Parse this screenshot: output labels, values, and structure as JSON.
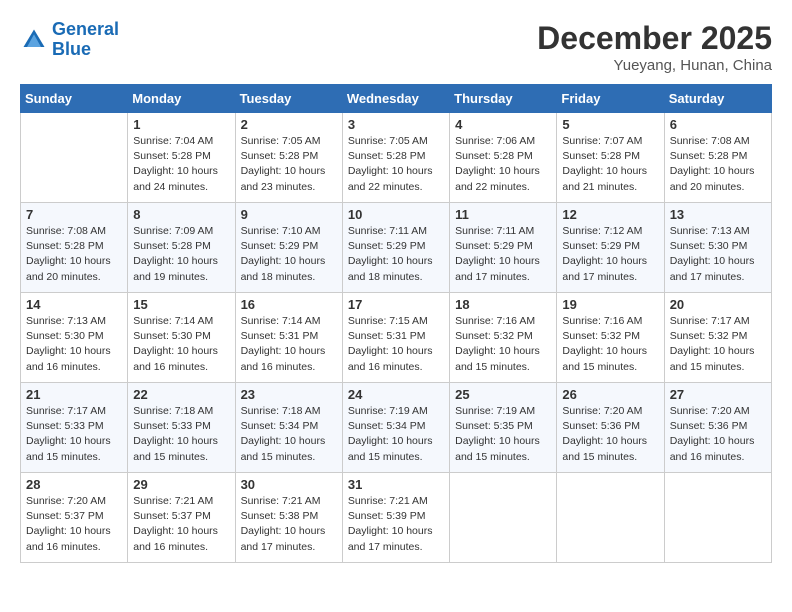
{
  "header": {
    "logo_line1": "General",
    "logo_line2": "Blue",
    "month": "December 2025",
    "location": "Yueyang, Hunan, China"
  },
  "weekdays": [
    "Sunday",
    "Monday",
    "Tuesday",
    "Wednesday",
    "Thursday",
    "Friday",
    "Saturday"
  ],
  "weeks": [
    [
      {
        "num": "",
        "sunrise": "",
        "sunset": "",
        "daylight": ""
      },
      {
        "num": "1",
        "sunrise": "Sunrise: 7:04 AM",
        "sunset": "Sunset: 5:28 PM",
        "daylight": "Daylight: 10 hours and 24 minutes."
      },
      {
        "num": "2",
        "sunrise": "Sunrise: 7:05 AM",
        "sunset": "Sunset: 5:28 PM",
        "daylight": "Daylight: 10 hours and 23 minutes."
      },
      {
        "num": "3",
        "sunrise": "Sunrise: 7:05 AM",
        "sunset": "Sunset: 5:28 PM",
        "daylight": "Daylight: 10 hours and 22 minutes."
      },
      {
        "num": "4",
        "sunrise": "Sunrise: 7:06 AM",
        "sunset": "Sunset: 5:28 PM",
        "daylight": "Daylight: 10 hours and 22 minutes."
      },
      {
        "num": "5",
        "sunrise": "Sunrise: 7:07 AM",
        "sunset": "Sunset: 5:28 PM",
        "daylight": "Daylight: 10 hours and 21 minutes."
      },
      {
        "num": "6",
        "sunrise": "Sunrise: 7:08 AM",
        "sunset": "Sunset: 5:28 PM",
        "daylight": "Daylight: 10 hours and 20 minutes."
      }
    ],
    [
      {
        "num": "7",
        "sunrise": "Sunrise: 7:08 AM",
        "sunset": "Sunset: 5:28 PM",
        "daylight": "Daylight: 10 hours and 20 minutes."
      },
      {
        "num": "8",
        "sunrise": "Sunrise: 7:09 AM",
        "sunset": "Sunset: 5:28 PM",
        "daylight": "Daylight: 10 hours and 19 minutes."
      },
      {
        "num": "9",
        "sunrise": "Sunrise: 7:10 AM",
        "sunset": "Sunset: 5:29 PM",
        "daylight": "Daylight: 10 hours and 18 minutes."
      },
      {
        "num": "10",
        "sunrise": "Sunrise: 7:11 AM",
        "sunset": "Sunset: 5:29 PM",
        "daylight": "Daylight: 10 hours and 18 minutes."
      },
      {
        "num": "11",
        "sunrise": "Sunrise: 7:11 AM",
        "sunset": "Sunset: 5:29 PM",
        "daylight": "Daylight: 10 hours and 17 minutes."
      },
      {
        "num": "12",
        "sunrise": "Sunrise: 7:12 AM",
        "sunset": "Sunset: 5:29 PM",
        "daylight": "Daylight: 10 hours and 17 minutes."
      },
      {
        "num": "13",
        "sunrise": "Sunrise: 7:13 AM",
        "sunset": "Sunset: 5:30 PM",
        "daylight": "Daylight: 10 hours and 17 minutes."
      }
    ],
    [
      {
        "num": "14",
        "sunrise": "Sunrise: 7:13 AM",
        "sunset": "Sunset: 5:30 PM",
        "daylight": "Daylight: 10 hours and 16 minutes."
      },
      {
        "num": "15",
        "sunrise": "Sunrise: 7:14 AM",
        "sunset": "Sunset: 5:30 PM",
        "daylight": "Daylight: 10 hours and 16 minutes."
      },
      {
        "num": "16",
        "sunrise": "Sunrise: 7:14 AM",
        "sunset": "Sunset: 5:31 PM",
        "daylight": "Daylight: 10 hours and 16 minutes."
      },
      {
        "num": "17",
        "sunrise": "Sunrise: 7:15 AM",
        "sunset": "Sunset: 5:31 PM",
        "daylight": "Daylight: 10 hours and 16 minutes."
      },
      {
        "num": "18",
        "sunrise": "Sunrise: 7:16 AM",
        "sunset": "Sunset: 5:32 PM",
        "daylight": "Daylight: 10 hours and 15 minutes."
      },
      {
        "num": "19",
        "sunrise": "Sunrise: 7:16 AM",
        "sunset": "Sunset: 5:32 PM",
        "daylight": "Daylight: 10 hours and 15 minutes."
      },
      {
        "num": "20",
        "sunrise": "Sunrise: 7:17 AM",
        "sunset": "Sunset: 5:32 PM",
        "daylight": "Daylight: 10 hours and 15 minutes."
      }
    ],
    [
      {
        "num": "21",
        "sunrise": "Sunrise: 7:17 AM",
        "sunset": "Sunset: 5:33 PM",
        "daylight": "Daylight: 10 hours and 15 minutes."
      },
      {
        "num": "22",
        "sunrise": "Sunrise: 7:18 AM",
        "sunset": "Sunset: 5:33 PM",
        "daylight": "Daylight: 10 hours and 15 minutes."
      },
      {
        "num": "23",
        "sunrise": "Sunrise: 7:18 AM",
        "sunset": "Sunset: 5:34 PM",
        "daylight": "Daylight: 10 hours and 15 minutes."
      },
      {
        "num": "24",
        "sunrise": "Sunrise: 7:19 AM",
        "sunset": "Sunset: 5:34 PM",
        "daylight": "Daylight: 10 hours and 15 minutes."
      },
      {
        "num": "25",
        "sunrise": "Sunrise: 7:19 AM",
        "sunset": "Sunset: 5:35 PM",
        "daylight": "Daylight: 10 hours and 15 minutes."
      },
      {
        "num": "26",
        "sunrise": "Sunrise: 7:20 AM",
        "sunset": "Sunset: 5:36 PM",
        "daylight": "Daylight: 10 hours and 15 minutes."
      },
      {
        "num": "27",
        "sunrise": "Sunrise: 7:20 AM",
        "sunset": "Sunset: 5:36 PM",
        "daylight": "Daylight: 10 hours and 16 minutes."
      }
    ],
    [
      {
        "num": "28",
        "sunrise": "Sunrise: 7:20 AM",
        "sunset": "Sunset: 5:37 PM",
        "daylight": "Daylight: 10 hours and 16 minutes."
      },
      {
        "num": "29",
        "sunrise": "Sunrise: 7:21 AM",
        "sunset": "Sunset: 5:37 PM",
        "daylight": "Daylight: 10 hours and 16 minutes."
      },
      {
        "num": "30",
        "sunrise": "Sunrise: 7:21 AM",
        "sunset": "Sunset: 5:38 PM",
        "daylight": "Daylight: 10 hours and 17 minutes."
      },
      {
        "num": "31",
        "sunrise": "Sunrise: 7:21 AM",
        "sunset": "Sunset: 5:39 PM",
        "daylight": "Daylight: 10 hours and 17 minutes."
      },
      {
        "num": "",
        "sunrise": "",
        "sunset": "",
        "daylight": ""
      },
      {
        "num": "",
        "sunrise": "",
        "sunset": "",
        "daylight": ""
      },
      {
        "num": "",
        "sunrise": "",
        "sunset": "",
        "daylight": ""
      }
    ]
  ]
}
